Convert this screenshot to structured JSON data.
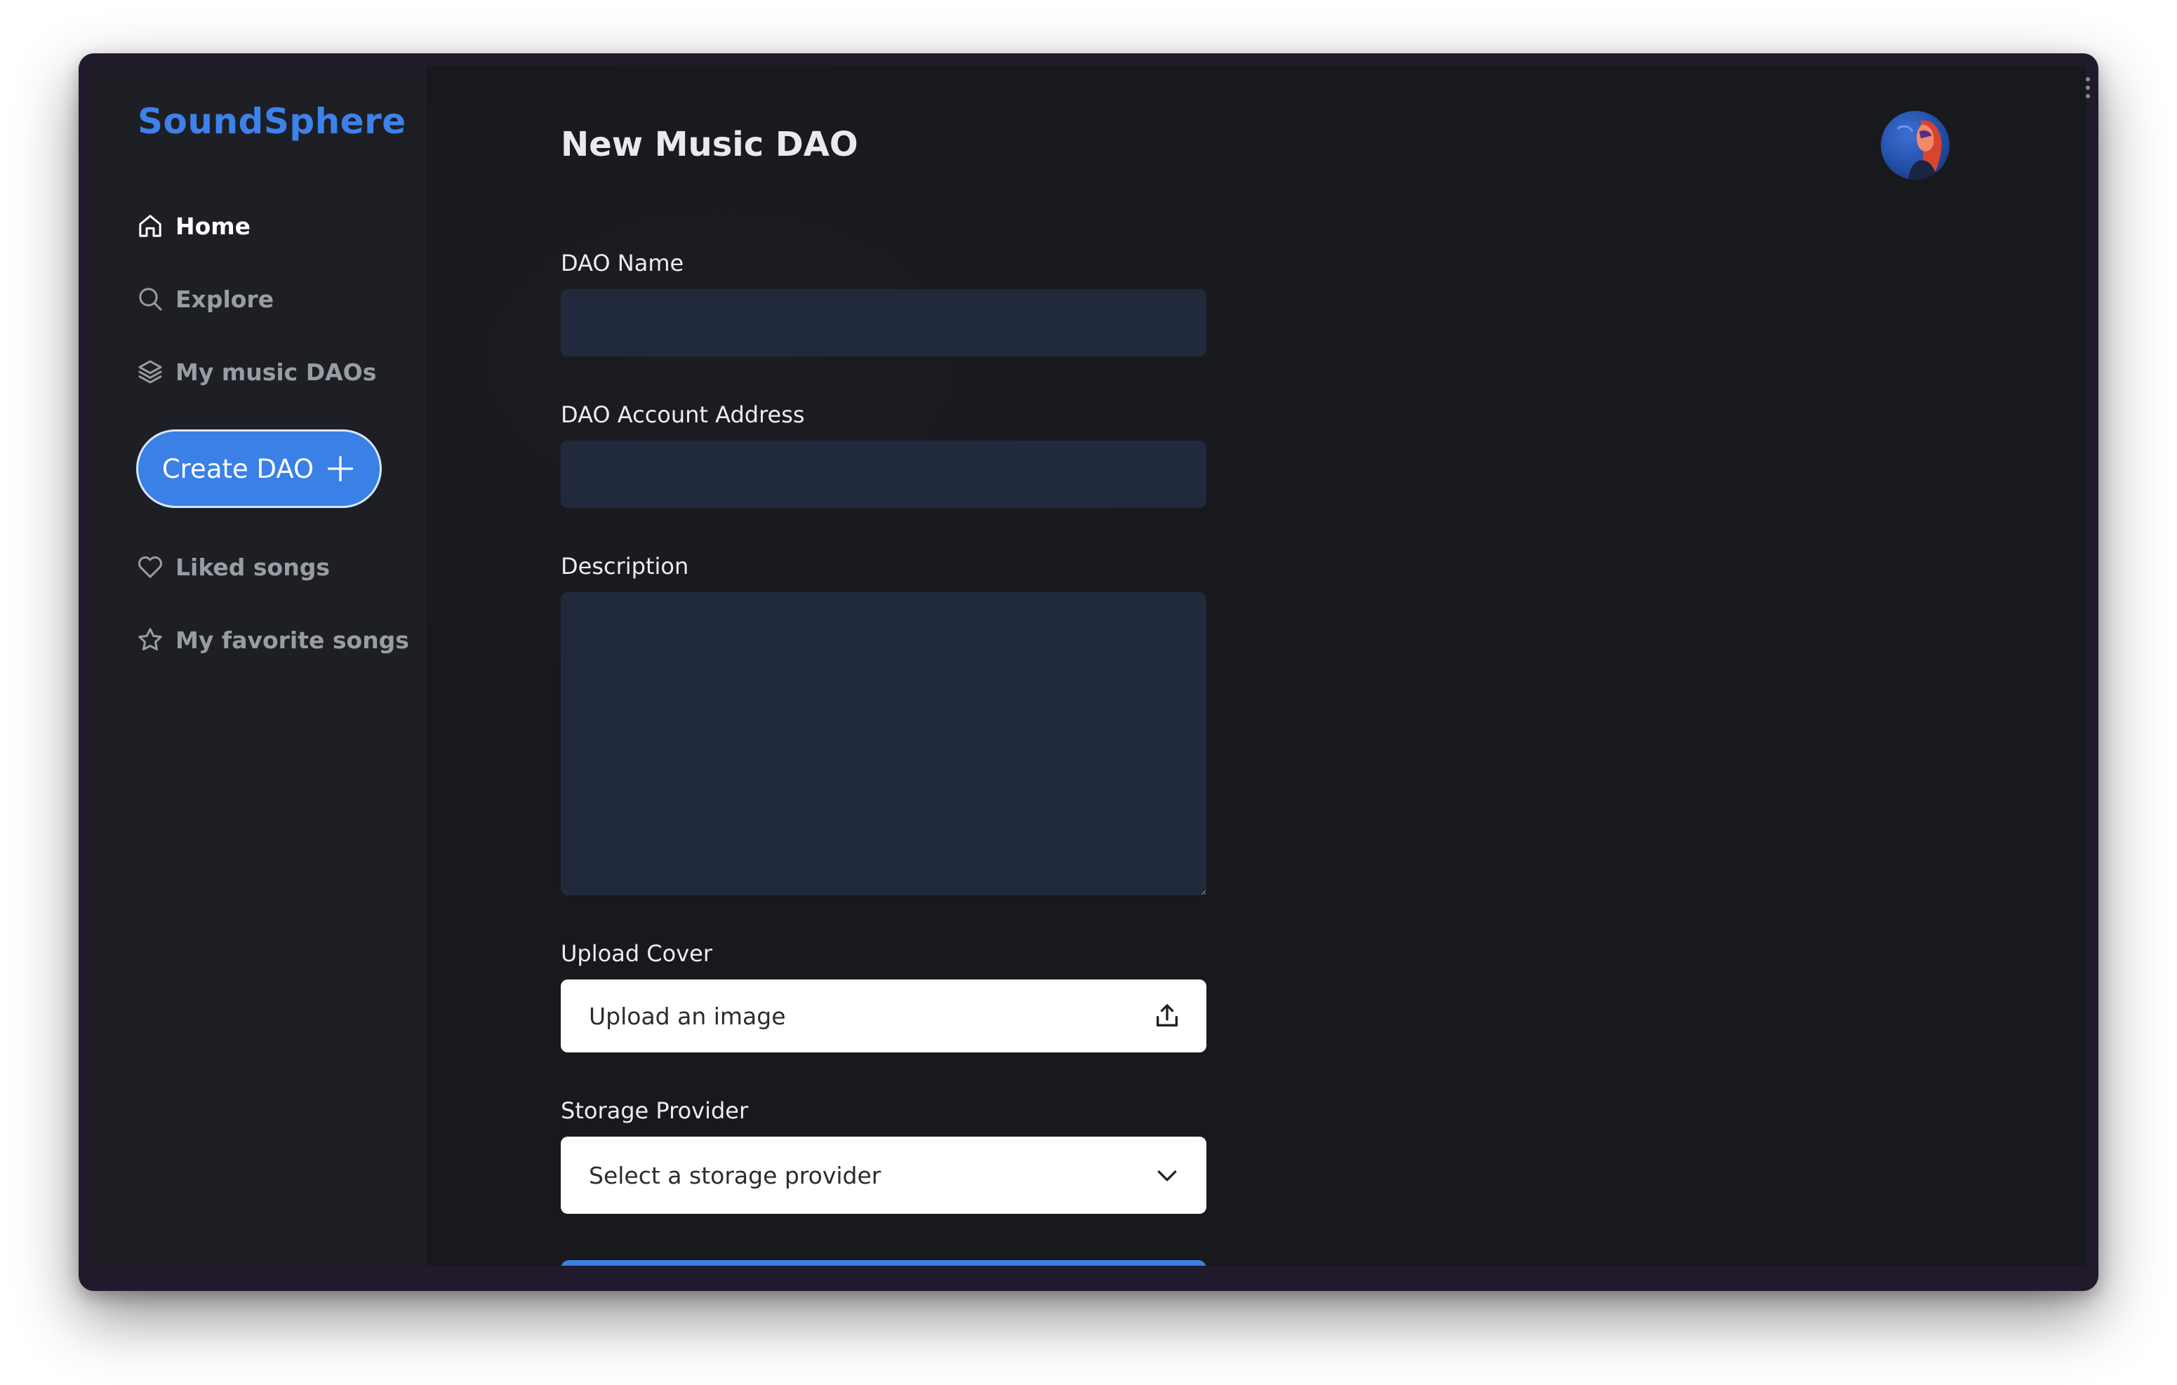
{
  "app": {
    "name": "SoundSphere",
    "brand_color": "#3c82ec"
  },
  "sidebar": {
    "items": [
      {
        "label": "Home",
        "icon": "home-icon",
        "active": true
      },
      {
        "label": "Explore",
        "icon": "search-icon",
        "active": false
      },
      {
        "label": "My music DAOs",
        "icon": "layers-icon",
        "active": false
      }
    ],
    "create_button": {
      "label": "Create DAO",
      "icon": "plus-icon"
    },
    "secondary_items": [
      {
        "label": "Liked songs",
        "icon": "heart-icon"
      },
      {
        "label": "My favorite songs",
        "icon": "star-icon"
      }
    ]
  },
  "header": {
    "title": "New Music DAO",
    "avatar": "user-avatar"
  },
  "form": {
    "dao_name": {
      "label": "DAO Name",
      "value": "",
      "placeholder": ""
    },
    "dao_account_address": {
      "label": "DAO Account Address",
      "value": "",
      "placeholder": ""
    },
    "description": {
      "label": "Description",
      "value": "",
      "placeholder": ""
    },
    "upload_cover": {
      "label": "Upload Cover",
      "button_text": "Upload an image",
      "icon": "upload-icon"
    },
    "storage_provider": {
      "label": "Storage Provider",
      "selected": "Select a storage provider",
      "icon": "chevron-down-icon"
    }
  },
  "colors": {
    "accent": "#3a80e6",
    "sidebar_bg": "#1e1f24",
    "main_bg": "#18191d",
    "input_bg": "#212a3c"
  }
}
